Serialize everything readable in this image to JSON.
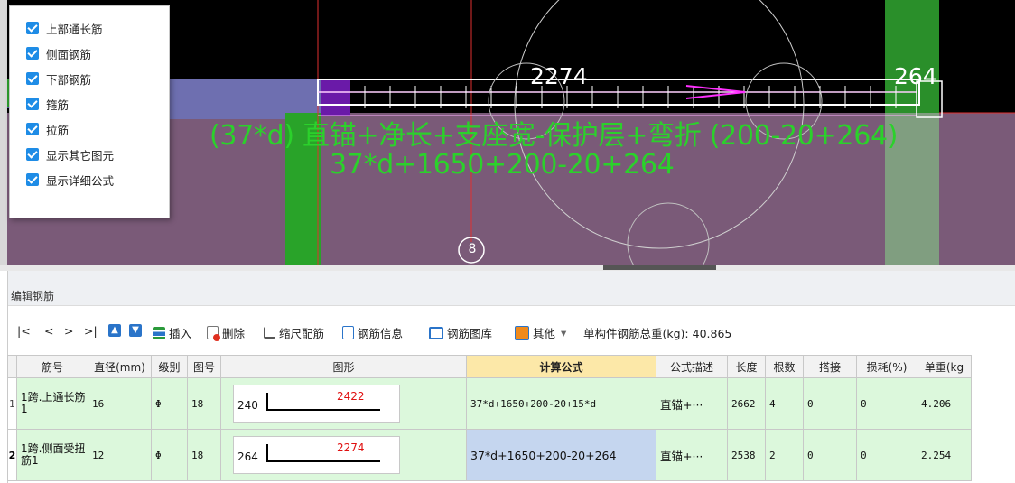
{
  "viewport": {
    "dim_left": "2274",
    "dim_right": "264",
    "formula_desc": "(37*d) 直锚+净长+支座宽-保护层+弯折 (200-20+264)",
    "formula_value": "37*d+1650+200-20+264",
    "axis_label": "8"
  },
  "checkbox_panel": {
    "items": [
      {
        "label": "上部通长筋",
        "checked": true
      },
      {
        "label": "侧面钢筋",
        "checked": true
      },
      {
        "label": "下部钢筋",
        "checked": true
      },
      {
        "label": "箍筋",
        "checked": true
      },
      {
        "label": "拉筋",
        "checked": true
      },
      {
        "label": "显示其它图元",
        "checked": true
      },
      {
        "label": "显示详细公式",
        "checked": true
      }
    ]
  },
  "editor": {
    "title": "编辑钢筋",
    "toolbar": {
      "first": "|<",
      "prev": "<",
      "next": ">",
      "last": ">|",
      "insert": "插入",
      "delete": "删除",
      "scale": "缩尺配筋",
      "info": "钢筋信息",
      "library": "钢筋图库",
      "other": "其他",
      "other_arrow": "▾",
      "total_label": "单构件钢筋总重(kg): 40.865"
    },
    "columns": [
      "",
      "筋号",
      "直径(mm)",
      "级别",
      "图号",
      "图形",
      "计算公式",
      "公式描述",
      "长度",
      "根数",
      "搭接",
      "损耗(%)",
      "单重(kg"
    ],
    "rows": [
      {
        "num": "1",
        "name": "1跨.上通长筋1",
        "diameter": "16",
        "grade": "Φ",
        "figure": "18",
        "shape_left": "240",
        "shape_len": "2422",
        "formula": "37*d+1650+200-20+15*d",
        "desc": "直锚+···",
        "length": "2662",
        "count": "4",
        "lap": "0",
        "loss": "0",
        "unit_weight": "4.206"
      },
      {
        "num": "2",
        "name": "1跨.侧面受扭筋1",
        "diameter": "12",
        "grade": "Φ",
        "figure": "18",
        "shape_left": "264",
        "shape_len": "2274",
        "formula": "37*d+1650+200-20+264",
        "desc": "直锚+···",
        "length": "2538",
        "count": "2",
        "lap": "0",
        "loss": "0",
        "unit_weight": "2.254"
      }
    ]
  }
}
